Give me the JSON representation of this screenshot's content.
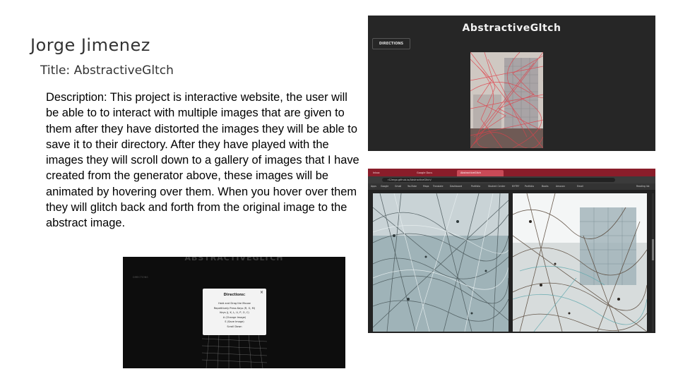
{
  "author": "Jorge Jimenez",
  "title": "Title: AbstractiveGltch",
  "description": "Description: This project is interactive website, the user will be able to to interact with multiple images that are given to them after they have distorted the images they will be able to save it to their directory. After they have played with the images they will scroll down to a gallery of images that I have created from the generator above, these images will be animated by hovering over them. When you hover over them they will glitch back and forth from the original image to the abstract image.",
  "screenshot_app": {
    "title": "AbstractiveGltch",
    "directions_button": "DIRECTIONS"
  },
  "screenshot_modal": {
    "background_title": "ABSTRACTIVEGLTCH",
    "background_button": "DIRECTIONS",
    "modal_title": "Directions:",
    "close_glyph": "×",
    "lines": [
      "Hold and Drag the Mouse",
      "Repetitively Press Keys (R, G, M)",
      "Keys (J, K, L, U, P, O, C)",
      "A (Change Image)",
      "S (Save Image)",
      "Scroll Down"
    ]
  },
  "screenshot_browser": {
    "tabs": [
      "Inbox",
      "Google Docs",
      "AbstractiveGltch"
    ],
    "url": "r12ergo.github.io/AbstractiveGltch/",
    "bookmarks": [
      "Apps",
      "Google",
      "Gmail",
      "YouTube",
      "Maps",
      "Translate",
      "Dashboard",
      "Portfolio",
      "Student Center",
      "NYTRF",
      "Portfolio",
      "Books",
      "Amazon",
      "Email",
      "Reading list"
    ]
  },
  "colors": {
    "app_background": "#262626",
    "browser_tabbar": "#8a1d2a",
    "glitch_red": "#e0404a"
  }
}
